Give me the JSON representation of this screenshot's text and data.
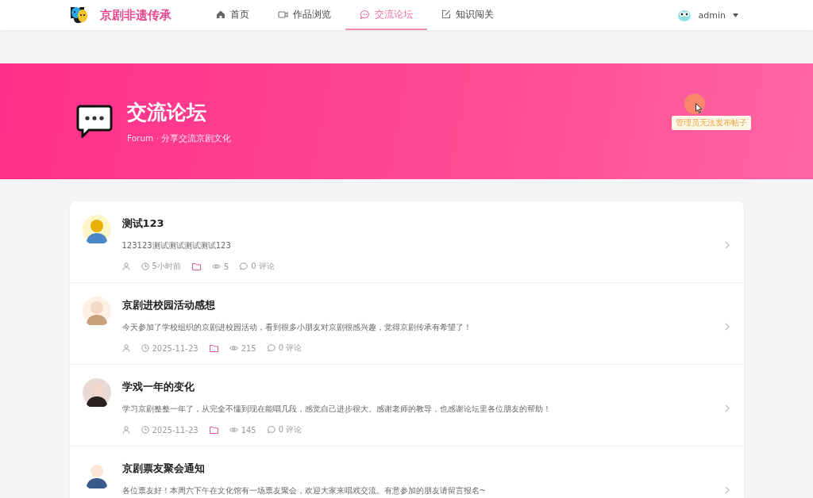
{
  "brand": {
    "name": "京剧非遗传承"
  },
  "nav": [
    {
      "label": "首页",
      "kind": "home",
      "selected": false
    },
    {
      "label": "作品浏览",
      "kind": "video",
      "selected": false
    },
    {
      "label": "交流论坛",
      "kind": "chat",
      "selected": true
    },
    {
      "label": "知识闯关",
      "kind": "edit",
      "selected": false
    }
  ],
  "user": {
    "name": "admin"
  },
  "hero": {
    "title": "交流论坛",
    "subtitle": "Forum · 分享交流京剧文化",
    "tooltip": "管理员无法发布帖子"
  },
  "posts": [
    {
      "title": "测试123",
      "excerpt": "123123测试测试测试测试123",
      "time": "5小时前",
      "views": "5",
      "comments": "0 评论"
    },
    {
      "title": "京剧进校园活动感想",
      "excerpt": "今天参加了学校组织的京剧进校园活动，看到很多小朋友对京剧很感兴趣，觉得京剧传承有希望了！",
      "time": "2025-11-23",
      "views": "215",
      "comments": "0 评论"
    },
    {
      "title": "学戏一年的变化",
      "excerpt": "学习京剧整整一年了，从完全不懂到现在能唱几段，感觉自己进步很大。感谢老师的教导，也感谢论坛里各位朋友的帮助！",
      "time": "2025-11-23",
      "views": "145",
      "comments": "0 评论"
    },
    {
      "title": "京剧票友聚会通知",
      "excerpt": "各位票友好！本周六下午在文化馆有一场票友聚会，欢迎大家来唱戏交流。有意参加的朋友请留言报名~"
    }
  ]
}
